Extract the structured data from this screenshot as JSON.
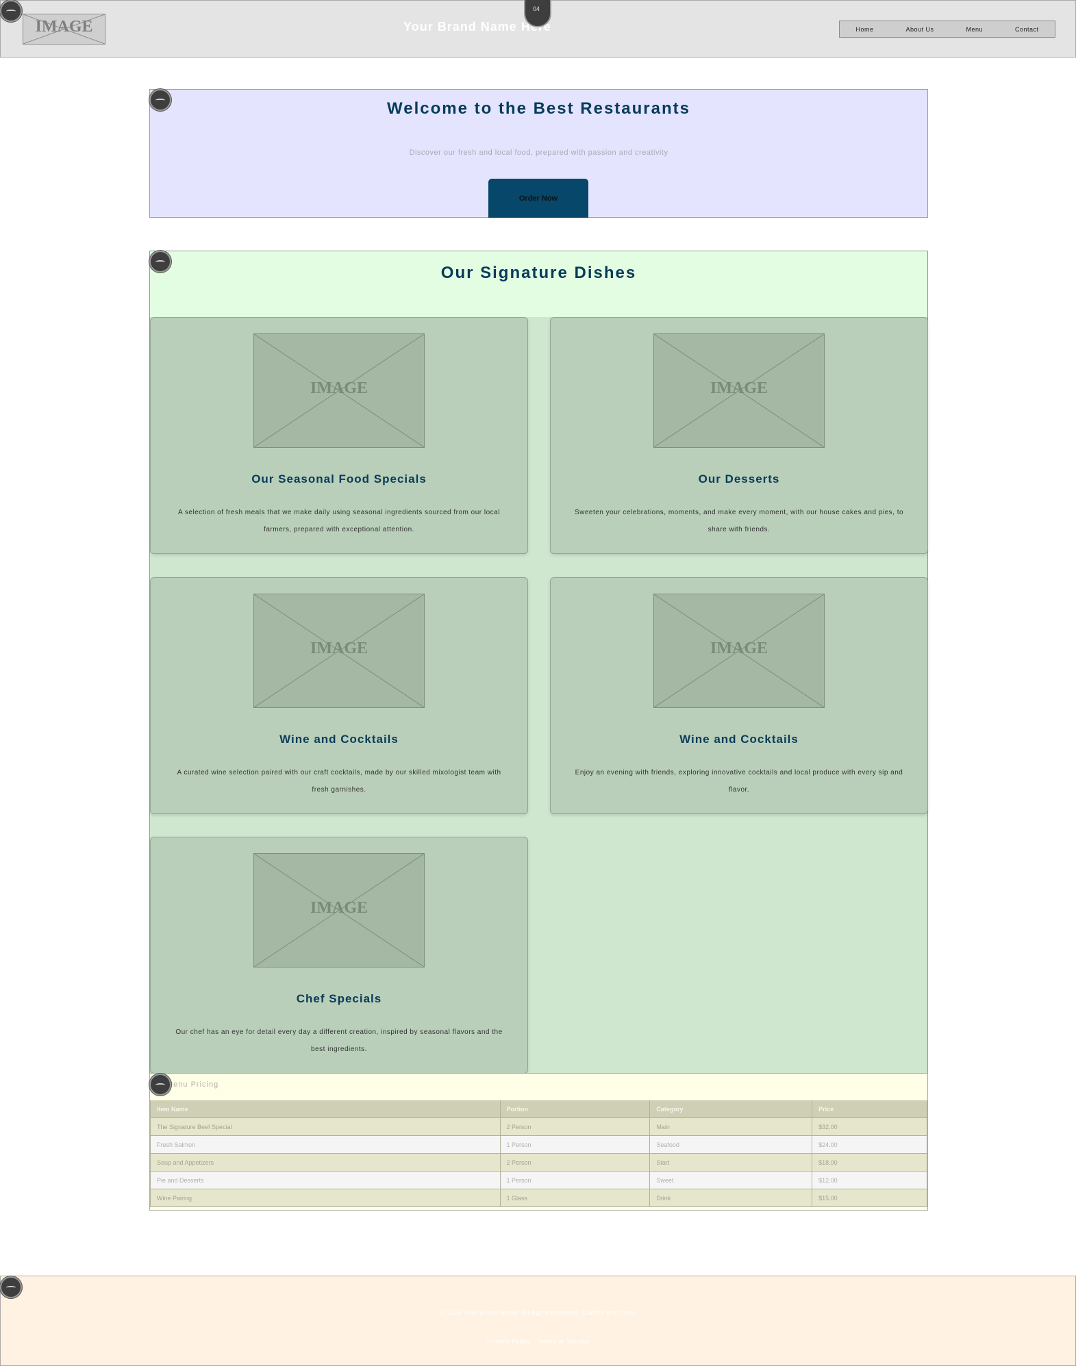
{
  "header": {
    "logo_text": "IMAGE",
    "title": "Your Brand Name Here",
    "tab_marker_label": "04",
    "nav": [
      "Home",
      "About Us",
      "Menu",
      "Contact"
    ]
  },
  "hero": {
    "title": "Welcome to the Best Restaurants",
    "subtitle": "Discover our fresh and local food, prepared with passion and creativity",
    "button_label": "Order Now"
  },
  "features": {
    "title": "Our Signature Dishes",
    "image_placeholder": "IMAGE",
    "cards": [
      {
        "title": "Our Seasonal Food Specials",
        "desc": "A selection of fresh meals that we make daily using seasonal ingredients sourced from our local farmers, prepared with exceptional attention."
      },
      {
        "title": "Our Desserts",
        "desc": "Sweeten your celebrations, moments, and make every moment, with our house cakes and pies, to share with friends."
      },
      {
        "title": "Wine and Cocktails",
        "desc": "A curated wine selection paired with our craft cocktails, made by our skilled mixologist team with fresh garnishes."
      },
      {
        "title": "Wine and Cocktails",
        "desc": "Enjoy an evening with friends, exploring innovative cocktails and local produce with every sip and flavor."
      },
      {
        "title": "Chef Specials",
        "desc": "Our chef has an eye for detail every day a different creation, inspired by seasonal flavors and the best ingredients."
      }
    ]
  },
  "pricing": {
    "title": "Menu Pricing",
    "columns": [
      "Item Name",
      "Portion",
      "Category",
      "Price"
    ],
    "rows": [
      [
        "The Signature Beef Special",
        "2 Person",
        "Main",
        "$32.00"
      ],
      [
        "Fresh Salmon",
        "1 Person",
        "Seafood",
        "$24.00"
      ],
      [
        "Soup and Appetizers",
        "2 Person",
        "Start",
        "$18.00"
      ],
      [
        "Pie and Desserts",
        "1 Person",
        "Sweet",
        "$12.00"
      ],
      [
        "Wine Pairing",
        "1 Glass",
        "Drink",
        "$15.00"
      ]
    ]
  },
  "footer": {
    "copyright": "© 2024 Your Brand Name. All rights reserved. Crafted with care.",
    "links": [
      "Privacy Policy",
      "Terms of Service"
    ]
  }
}
